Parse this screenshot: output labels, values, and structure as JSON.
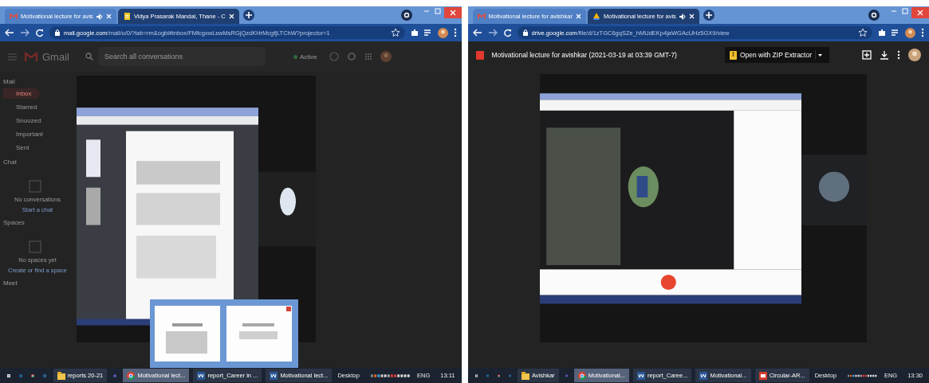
{
  "panels": [
    {
      "tabs": [
        {
          "title": "Motivational lecture for avis",
          "kind": "gmail",
          "audio": true,
          "selected": false
        },
        {
          "title": "Vidya Prasarak Mandal, Thane - C",
          "kind": "doc",
          "audio": false,
          "selected": true
        }
      ],
      "url": {
        "host": "mail.google.com",
        "path": "/mail/u/0/?tab=rm&ogbl#inbox/FMfcgxwLswMsRGjQzdKHrMcgfjLTChW?projector=1"
      },
      "page": {
        "kind": "gmail",
        "app_name": "Gmail",
        "search_placeholder": "Search all conversations",
        "status": "Active",
        "sections": [
          {
            "label": "Mail",
            "items": [
              {
                "label": "Inbox",
                "selected": true
              },
              {
                "label": "Starred",
                "selected": false
              },
              {
                "label": "Snoozed",
                "selected": false
              },
              {
                "label": "Important",
                "selected": false
              },
              {
                "label": "Sent",
                "selected": false
              }
            ]
          },
          {
            "label": "Chat",
            "empty": "No conversations",
            "action": "Start a chat"
          },
          {
            "label": "Spaces",
            "empty": "No spaces yet",
            "action": "Create or find a space"
          },
          {
            "label": "Meet"
          }
        ]
      },
      "taskbar": {
        "items": [
          {
            "label": "reports 20-21",
            "kind": "folder",
            "selected": false
          },
          {
            "label": "Motivational lect...",
            "kind": "chrome",
            "selected": true
          },
          {
            "label": "report_Career in ...",
            "kind": "word",
            "selected": false
          },
          {
            "label": "Motivational lect...",
            "kind": "word",
            "selected": false
          }
        ],
        "desktop": "Desktop",
        "lang": "ENG",
        "time": "13:11"
      }
    },
    {
      "tabs": [
        {
          "title": "Motivational lecture for avishkar",
          "kind": "gmail",
          "audio": false,
          "selected": false
        },
        {
          "title": "Motivational lecture for avis",
          "kind": "drive",
          "audio": true,
          "selected": true
        }
      ],
      "url": {
        "host": "drive.google.com",
        "path": "/file/d/1zTGC6gqSZe_hMUdEKp4jaWGAcUHz5GX9/view"
      },
      "page": {
        "kind": "drive",
        "title": "Motivational lecture for avishkar (2021-03-19 at 03:39 GMT-7)",
        "open_with": "Open with ZIP Extractor"
      },
      "taskbar": {
        "items": [
          {
            "label": "Avishkar",
            "kind": "folder",
            "selected": false
          },
          {
            "label": "Motivational...",
            "kind": "chrome",
            "selected": true
          },
          {
            "label": "report_Caree...",
            "kind": "word",
            "selected": false
          },
          {
            "label": "Motivational...",
            "kind": "word",
            "selected": false
          },
          {
            "label": "Circular-AR...",
            "kind": "pdf",
            "selected": false
          }
        ],
        "desktop": "Desktop",
        "lang": "ENG",
        "time": "13:30"
      }
    }
  ]
}
